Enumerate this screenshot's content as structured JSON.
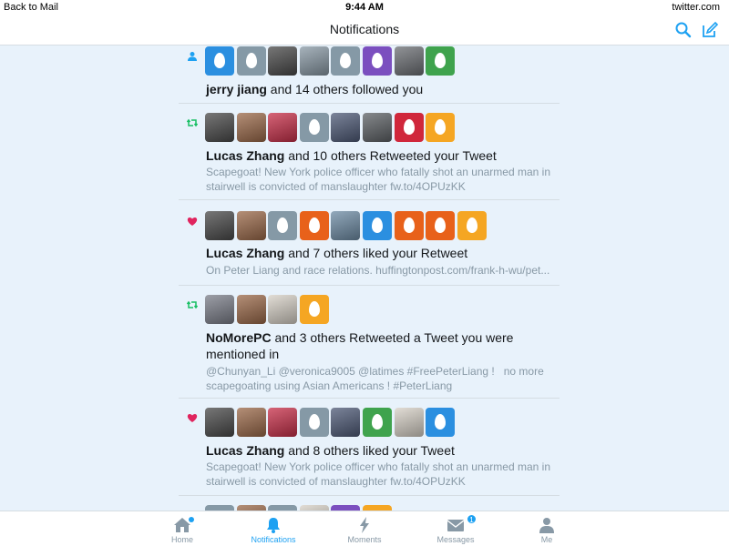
{
  "status_bar": {
    "back": "Back to Mail",
    "time": "9:44 AM",
    "site": "twitter.com"
  },
  "nav": {
    "title": "Notifications"
  },
  "colors": {
    "accent": "#1da1f2",
    "like": "#e0245e",
    "retweet": "#17bf63",
    "egg_gray": "#8899a6"
  },
  "notifications": [
    {
      "type": "follow",
      "avatars": [
        "egg:#2b8fe0",
        "egg:#8599a6",
        "photo:#4a4a4a",
        "photo:#8a9aa6",
        "egg:#8599a6",
        "egg:#7b4fbf",
        "photo:#6d7075",
        "egg:#3fa34d"
      ],
      "actor": "jerry jiang",
      "action": " and 14 others followed you",
      "snippet_lines": []
    },
    {
      "type": "retweet",
      "avatars": [
        "photo:#4a4a4a",
        "photo:#9c6a4a",
        "photo:#c9304a",
        "egg:#8599a6",
        "photo:#4f5b78",
        "photo:#5e6266",
        "egg:#d0273b",
        "egg:#f5a623"
      ],
      "actor": "Lucas Zhang",
      "action": " and 10 others Retweeted your Tweet",
      "snippet_lines": [
        "Scapegoat! New York police officer who fatally shot an unarmed man in",
        "stairwell is convicted of manslaughter fw.to/4OPUzKK"
      ]
    },
    {
      "type": "like",
      "avatars": [
        "photo:#4a4a4a",
        "photo:#9c6a4a",
        "egg:#8599a6",
        "egg:#e8611a",
        "photo:#6f8da6",
        "egg:#2b8fe0",
        "egg:#e8611a",
        "egg:#e8611a",
        "egg:#f5a623"
      ],
      "actor": "Lucas Zhang",
      "action": " and 7 others liked your Retweet",
      "snippet_lines": [
        "On Peter Liang and race relations. huffingtonpost.com/frank-h-wu/pet..."
      ]
    },
    {
      "type": "retweet",
      "avatars": [
        "photo:#7c7f8a",
        "photo:#9c6a4a",
        "photo:#d8d2c8",
        "egg:#f5a623"
      ],
      "actor": "NoMorePC",
      "action": " and 3 others Retweeted a Tweet you were",
      "action_line2": "mentioned in",
      "snippet_lines": [
        "@Chunyan_Li @veronica9005 @latimes #FreePeterLiang !   no more",
        "scapegoating using Asian Americans ! #PeterLiang"
      ]
    },
    {
      "type": "like",
      "avatars": [
        "photo:#4a4a4a",
        "photo:#9c6a4a",
        "photo:#c9304a",
        "egg:#8599a6",
        "photo:#4f5b78",
        "egg:#3fa34d",
        "photo:#d8d2c8",
        "egg:#2b8fe0"
      ],
      "actor": "Lucas Zhang",
      "action": " and 8 others liked your Tweet",
      "snippet_lines": [
        "Scapegoat! New York police officer who fatally shot an unarmed man in",
        "stairwell is convicted of manslaughter fw.to/4OPUzKK"
      ]
    },
    {
      "type": "like",
      "avatars": [
        "egg:#8599a6",
        "photo:#9c6a4a",
        "egg:#8599a6",
        "photo:#d8d2c8",
        "egg:#7b4fbf",
        "egg:#f5a623"
      ],
      "actor": "",
      "action": "",
      "snippet_lines": []
    }
  ],
  "tabs": [
    {
      "label": "Home",
      "icon": "home-icon"
    },
    {
      "label": "Notifications",
      "icon": "bell-icon"
    },
    {
      "label": "Moments",
      "icon": "lightning-icon"
    },
    {
      "label": "Messages",
      "icon": "envelope-icon",
      "badge": "1"
    },
    {
      "label": "Me",
      "icon": "person-icon"
    }
  ]
}
